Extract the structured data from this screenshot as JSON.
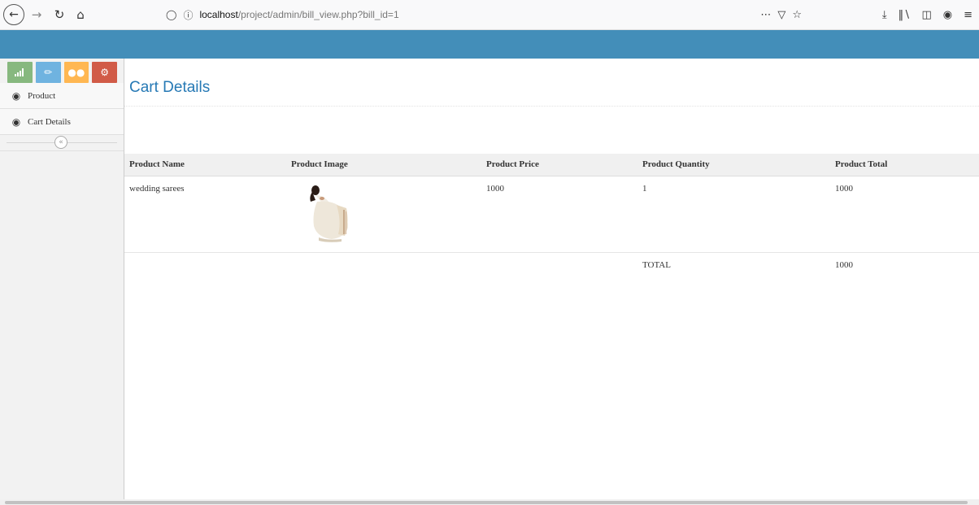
{
  "browser": {
    "url_host": "localhost",
    "url_path": "/project/admin/bill_view.php?bill_id=1"
  },
  "icons": {
    "back": "back-arrow-icon",
    "forward": "forward-arrow-icon",
    "reload": "reload-icon",
    "home": "home-icon",
    "shield": "tracking-shield-icon",
    "info": "info-icon",
    "more": "more-actions-icon",
    "pocket": "pocket-icon",
    "bookmark": "bookmark-star-icon",
    "download": "download-icon",
    "library": "library-icon",
    "sidebar": "sidebar-toggle-icon",
    "account": "account-icon",
    "menu": "hamburger-menu-icon"
  },
  "colors": {
    "header": "#438eb9",
    "title": "#2679b5",
    "shortcut_green": "#87b87f",
    "shortcut_blue": "#6fb3e0",
    "shortcut_orange": "#ffb752",
    "shortcut_red": "#d15b47"
  },
  "sidebar": {
    "shortcuts": [
      {
        "icon": "signal-icon"
      },
      {
        "icon": "pencil-icon"
      },
      {
        "icon": "users-icon"
      },
      {
        "icon": "cogs-icon"
      }
    ],
    "items": [
      {
        "label": "Product",
        "icon": "dashboard-icon"
      },
      {
        "label": "Cart Details",
        "icon": "dashboard-icon"
      }
    ]
  },
  "main": {
    "title": "Cart Details",
    "table": {
      "columns": [
        "Product Name",
        "Product Image",
        "Product Price",
        "Product Quantity",
        "Product Total"
      ],
      "rows": [
        {
          "name": "wedding sarees",
          "price": "1000",
          "quantity": "1",
          "total": "1000"
        }
      ],
      "total_label": "TOTAL",
      "total_value": "1000"
    }
  }
}
